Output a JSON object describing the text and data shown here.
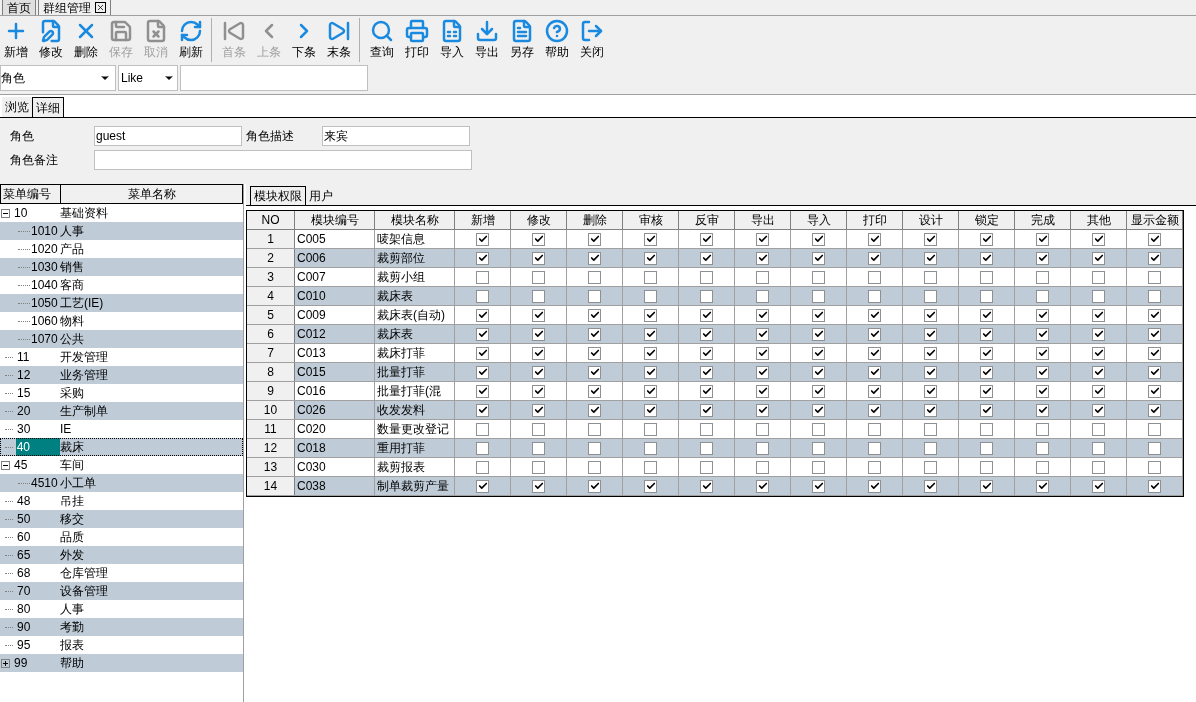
{
  "doc_tabs": [
    {
      "label": "首页",
      "selected": false,
      "closable": false
    },
    {
      "label": "群组管理",
      "selected": true,
      "closable": true
    }
  ],
  "toolbar": {
    "groups": [
      [
        {
          "label": "新增",
          "disabled": false
        },
        {
          "label": "修改",
          "disabled": false
        },
        {
          "label": "删除",
          "disabled": false
        },
        {
          "label": "保存",
          "disabled": true
        },
        {
          "label": "取消",
          "disabled": true
        },
        {
          "label": "刷新",
          "disabled": false
        }
      ],
      [
        {
          "label": "首条",
          "disabled": true
        },
        {
          "label": "上条",
          "disabled": true
        },
        {
          "label": "下条",
          "disabled": false
        },
        {
          "label": "末条",
          "disabled": false
        }
      ],
      [
        {
          "label": "查询",
          "disabled": false
        },
        {
          "label": "打印",
          "disabled": false
        },
        {
          "label": "导入",
          "disabled": false
        },
        {
          "label": "导出",
          "disabled": false
        },
        {
          "label": "另存",
          "disabled": false
        },
        {
          "label": "帮助",
          "disabled": false
        },
        {
          "label": "关闭",
          "disabled": false
        }
      ]
    ]
  },
  "filter": {
    "field": "角色",
    "operator": "Like"
  },
  "view_tabs": [
    {
      "label": "浏览",
      "selected": false
    },
    {
      "label": "详细",
      "selected": true
    }
  ],
  "form": {
    "role_label": "角色",
    "role": "guest",
    "desc_label": "角色描述",
    "desc": "来宾",
    "note_label": "角色备注"
  },
  "tree": {
    "columns": [
      "菜单编号",
      "菜单名称"
    ],
    "items": [
      {
        "code": "10",
        "name": "基础资料",
        "expanded": true,
        "selected": false,
        "children": [
          {
            "code": "1010",
            "name": "人事",
            "selected": false
          },
          {
            "code": "1020",
            "name": "产品",
            "selected": false
          },
          {
            "code": "1030",
            "name": "销售",
            "selected": false
          },
          {
            "code": "1040",
            "name": "客商",
            "selected": false
          },
          {
            "code": "1050",
            "name": "工艺(IE)",
            "selected": false
          },
          {
            "code": "1060",
            "name": "物料",
            "selected": false
          },
          {
            "code": "1070",
            "name": "公共",
            "selected": false
          }
        ]
      },
      {
        "code": "11",
        "name": "开发管理",
        "selected": false
      },
      {
        "code": "12",
        "name": "业务管理",
        "selected": false
      },
      {
        "code": "15",
        "name": "采购",
        "selected": false
      },
      {
        "code": "20",
        "name": "生产制单",
        "selected": false
      },
      {
        "code": "30",
        "name": "IE",
        "selected": false
      },
      {
        "code": "40",
        "name": "裁床",
        "selected": true
      },
      {
        "code": "45",
        "name": "车间",
        "expanded": true,
        "selected": false,
        "children": [
          {
            "code": "4510",
            "name": "小工单",
            "selected": false
          }
        ]
      },
      {
        "code": "48",
        "name": "吊挂",
        "selected": false
      },
      {
        "code": "50",
        "name": "移交",
        "selected": false
      },
      {
        "code": "60",
        "name": "品质",
        "selected": false
      },
      {
        "code": "65",
        "name": "外发",
        "selected": false
      },
      {
        "code": "68",
        "name": "仓库管理",
        "selected": false
      },
      {
        "code": "70",
        "name": "设备管理",
        "selected": false
      },
      {
        "code": "80",
        "name": "人事",
        "selected": false
      },
      {
        "code": "90",
        "name": "考勤",
        "selected": false
      },
      {
        "code": "95",
        "name": "报表",
        "selected": false
      },
      {
        "code": "99",
        "name": "帮助",
        "expanded": false,
        "selected": false
      }
    ]
  },
  "detail_tabs": [
    {
      "label": "模块权限",
      "selected": true
    },
    {
      "label": "用户",
      "selected": false
    }
  ],
  "grid": {
    "columns": [
      "NO",
      "模块编号",
      "模块名称",
      "新增",
      "修改",
      "删除",
      "审核",
      "反审",
      "导出",
      "导入",
      "打印",
      "设计",
      "锁定",
      "完成",
      "其他",
      "显示金额"
    ],
    "rows": [
      {
        "no": "1",
        "code": "C005",
        "name": "唛架信息",
        "checks": [
          true,
          true,
          true,
          true,
          true,
          true,
          true,
          true,
          true,
          true,
          true,
          true,
          true
        ]
      },
      {
        "no": "2",
        "code": "C006",
        "name": "裁剪部位",
        "checks": [
          true,
          true,
          true,
          true,
          true,
          true,
          true,
          true,
          true,
          true,
          true,
          true,
          true
        ]
      },
      {
        "no": "3",
        "code": "C007",
        "name": "裁剪小组",
        "checks": [
          false,
          false,
          false,
          false,
          false,
          false,
          false,
          false,
          false,
          false,
          false,
          false,
          false
        ]
      },
      {
        "no": "4",
        "code": "C010",
        "name": "裁床表",
        "checks": [
          false,
          false,
          false,
          false,
          false,
          false,
          false,
          false,
          false,
          false,
          false,
          false,
          false
        ]
      },
      {
        "no": "5",
        "code": "C009",
        "name": "裁床表(自动)",
        "checks": [
          true,
          true,
          true,
          true,
          true,
          true,
          true,
          true,
          true,
          true,
          true,
          true,
          true
        ]
      },
      {
        "no": "6",
        "code": "C012",
        "name": "裁床表",
        "checks": [
          true,
          true,
          true,
          true,
          true,
          true,
          true,
          true,
          true,
          true,
          true,
          true,
          true
        ]
      },
      {
        "no": "7",
        "code": "C013",
        "name": "裁床打菲",
        "checks": [
          true,
          true,
          true,
          true,
          true,
          true,
          true,
          true,
          true,
          true,
          true,
          true,
          true
        ]
      },
      {
        "no": "8",
        "code": "C015",
        "name": "批量打菲",
        "checks": [
          true,
          true,
          true,
          true,
          true,
          true,
          true,
          true,
          true,
          true,
          true,
          true,
          true
        ]
      },
      {
        "no": "9",
        "code": "C016",
        "name": "批量打菲(混",
        "checks": [
          true,
          true,
          true,
          true,
          true,
          true,
          true,
          true,
          true,
          true,
          true,
          true,
          true
        ]
      },
      {
        "no": "10",
        "code": "C026",
        "name": "收发发料",
        "checks": [
          true,
          true,
          true,
          true,
          true,
          true,
          true,
          true,
          true,
          true,
          true,
          true,
          true
        ]
      },
      {
        "no": "11",
        "code": "C020",
        "name": "数量更改登记",
        "checks": [
          false,
          false,
          false,
          false,
          false,
          false,
          false,
          false,
          false,
          false,
          false,
          false,
          false
        ]
      },
      {
        "no": "12",
        "code": "C018",
        "name": "重用打菲",
        "checks": [
          false,
          false,
          false,
          false,
          false,
          false,
          false,
          false,
          false,
          false,
          false,
          false,
          false
        ]
      },
      {
        "no": "13",
        "code": "C030",
        "name": "裁剪报表",
        "checks": [
          false,
          false,
          false,
          false,
          false,
          false,
          false,
          false,
          false,
          false,
          false,
          false,
          false
        ]
      },
      {
        "no": "14",
        "code": "C038",
        "name": "制单裁剪产量",
        "checks": [
          true,
          true,
          true,
          true,
          true,
          true,
          true,
          true,
          true,
          true,
          true,
          true,
          true
        ]
      }
    ]
  }
}
